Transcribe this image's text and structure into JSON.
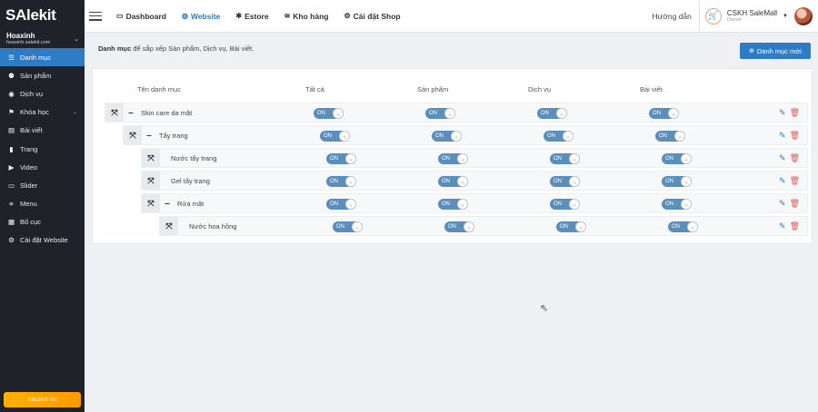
{
  "brand": {
    "logo": "SAlekit"
  },
  "shop": {
    "name": "Hoaxinh",
    "domain": "hoaxinh.salekit.com"
  },
  "sidebar": {
    "items": [
      {
        "label": "Danh mục",
        "icon": "list-icon",
        "glyph": "☰",
        "active": true
      },
      {
        "label": "Sản phẩm",
        "icon": "box-icon",
        "glyph": "⚉"
      },
      {
        "label": "Dịch vụ",
        "icon": "service-icon",
        "glyph": "◉"
      },
      {
        "label": "Khóa học",
        "icon": "course-icon",
        "glyph": "⚑",
        "chevron": true
      },
      {
        "label": "Bài viết",
        "icon": "article-icon",
        "glyph": "▤"
      },
      {
        "label": "Trang",
        "icon": "page-icon",
        "glyph": "▮"
      },
      {
        "label": "Video",
        "icon": "video-icon",
        "glyph": "▶"
      },
      {
        "label": "Slider",
        "icon": "slider-icon",
        "glyph": "▭"
      },
      {
        "label": "Menu",
        "icon": "menu-icon",
        "glyph": "≡"
      },
      {
        "label": "Bố cục",
        "icon": "layout-icon",
        "glyph": "▦"
      },
      {
        "label": "Cài đặt Website",
        "icon": "gear-icon",
        "glyph": "⚙"
      }
    ],
    "promo_label": "SALEKIT.VN"
  },
  "topbar": {
    "nav": [
      {
        "label": "Dashboard",
        "icon": "monitor-icon",
        "glyph": "▭"
      },
      {
        "label": "Website",
        "icon": "globe-icon",
        "glyph": "◍",
        "active": true
      },
      {
        "label": "Estore",
        "icon": "store-icon",
        "glyph": "✱"
      },
      {
        "label": "Kho hàng",
        "icon": "warehouse-icon",
        "glyph": "≋"
      },
      {
        "label": "Cài đặt Shop",
        "icon": "gear-icon",
        "glyph": "⚙"
      }
    ],
    "help": "Hướng dẫn",
    "user_name": "CSKH SaleMall",
    "user_role": "Owner"
  },
  "page": {
    "description_bold": "Danh mục",
    "description_rest": " để sắp xếp Sản phẩm, Dịch vụ, Bài viết.",
    "new_button": "Danh mục mới"
  },
  "table": {
    "headers": {
      "name": "Tên danh mục",
      "all": "Tất cả",
      "products": "Sản phẩm",
      "services": "Dịch vụ",
      "articles": "Bài viết"
    },
    "toggle_label": "ON",
    "rows": [
      {
        "name": "Skin care da mặt",
        "level": 0,
        "expandable": true
      },
      {
        "name": "Tẩy trang",
        "level": 1,
        "expandable": true
      },
      {
        "name": "Nước tẩy trang",
        "level": 2,
        "expandable": false
      },
      {
        "name": "Gel tẩy trang",
        "level": 2,
        "expandable": false
      },
      {
        "name": "Rửa mặt",
        "level": 2,
        "expandable": true
      },
      {
        "name": "Nước hoa hồng",
        "level": 3,
        "expandable": false
      }
    ]
  }
}
